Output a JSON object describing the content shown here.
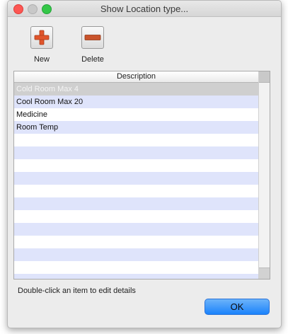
{
  "window": {
    "title": "Show Location type..."
  },
  "toolbar": {
    "new_label": "New",
    "delete_label": "Delete"
  },
  "table": {
    "column_header": "Description",
    "rows": [
      "Cold Room Max 4",
      "Cool Room Max 20",
      "Medicine",
      "Room Temp",
      "",
      "",
      "",
      "",
      "",
      "",
      "",
      "",
      "",
      "",
      "",
      ""
    ],
    "selected_row": 0
  },
  "footer": {
    "hint": "Double-click an item to edit details",
    "ok_label": "OK"
  },
  "colors": {
    "row_alt": "#dfe4fb",
    "selected_row": "#cfcfcf",
    "ok_button": "#1a82fb"
  },
  "icons": {
    "new": "plus-icon",
    "delete": "minus-icon"
  }
}
